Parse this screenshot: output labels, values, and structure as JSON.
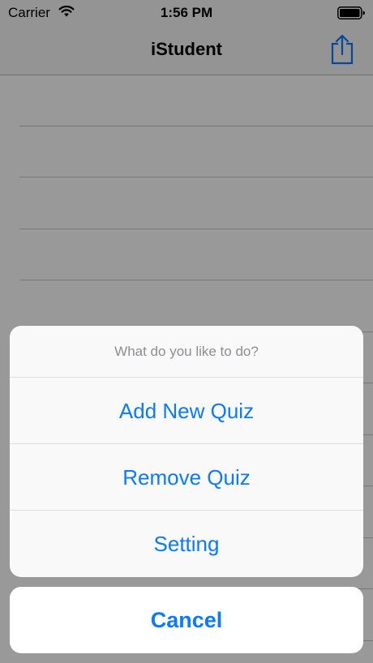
{
  "status_bar": {
    "carrier": "Carrier",
    "time": "1:56 PM",
    "wifi_icon": "wifi-icon",
    "battery_icon": "battery-full-icon"
  },
  "nav": {
    "title": "iStudent",
    "share_icon": "share-icon"
  },
  "action_sheet": {
    "title": "What do you like to do?",
    "actions": [
      {
        "label": "Add New Quiz"
      },
      {
        "label": "Remove Quiz"
      },
      {
        "label": "Setting"
      }
    ],
    "cancel_label": "Cancel"
  },
  "colors": {
    "accent": "#0a7aff",
    "nav_background": "#f7f7f7",
    "sheet_background": "#f9f9f9",
    "sheet_title": "#8e8e93",
    "overlay": "rgba(0,0,0,0.4)"
  }
}
